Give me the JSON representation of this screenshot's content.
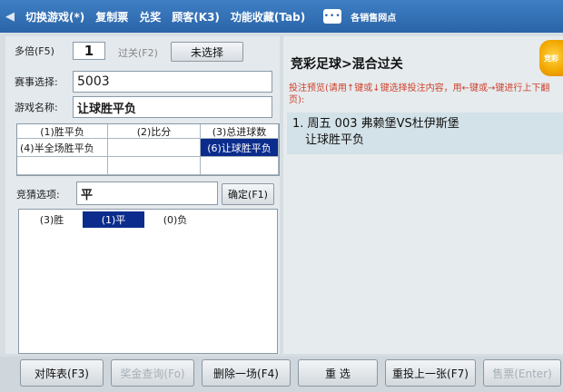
{
  "menubar": {
    "items": [
      "切换游戏(*)",
      "复制票",
      "兑奖",
      "顾客(K3)",
      "功能收藏(Tab)"
    ],
    "message_icon": "chat-bubble-icon",
    "outlet_label": "各销售网点"
  },
  "bet_form": {
    "multiple_label": "多倍(F5)",
    "multiple_value": "1",
    "pass_label": "过关(F2)",
    "pass_value": "未选择",
    "event_label": "赛事选择:",
    "event_value": "5003",
    "game_name_label": "游戏名称:",
    "game_name_value": "让球胜平负"
  },
  "play_types": {
    "rows": [
      [
        {
          "label": "(1)胜平负",
          "selected": false
        },
        {
          "label": "(2)比分",
          "selected": false
        },
        {
          "label": "(3)总进球数",
          "selected": false
        }
      ],
      [
        {
          "label": "(4)半全场胜平负",
          "selected": false
        },
        {
          "label": "",
          "selected": false
        },
        {
          "label": "(6)让球胜平负",
          "selected": true
        }
      ],
      [
        {
          "label": "",
          "selected": false
        },
        {
          "label": "",
          "selected": false
        },
        {
          "label": "",
          "selected": false
        }
      ]
    ]
  },
  "guess": {
    "label": "竞猜选项:",
    "value": "平",
    "confirm_label": "确定(F1)"
  },
  "options": [
    {
      "label": "(3)胜",
      "selected": false
    },
    {
      "label": "(1)平",
      "selected": true
    },
    {
      "label": "(0)负",
      "selected": false
    }
  ],
  "right_panel": {
    "title": "竞彩足球>混合过关",
    "logo_text": "竞彩",
    "hint": "投注预览(请用↑键或↓键选择投注内容，用←键或→键进行上下翻页):",
    "bet_line1": "1. 周五 003  弗赖堡VS杜伊斯堡",
    "bet_line2": "让球胜平负"
  },
  "bottom_buttons": [
    {
      "label": "对阵表(F3)",
      "enabled": true
    },
    {
      "label": "奖金查询(Fo)",
      "enabled": false
    },
    {
      "label": "删除一场(F4)",
      "enabled": true
    },
    {
      "label": "重  选",
      "enabled": true
    },
    {
      "label": "重投上一张(F7)",
      "enabled": true
    },
    {
      "label": "售票(Enter)",
      "enabled": false
    }
  ],
  "colors": {
    "menubar": "#2a64a8",
    "selection": "#0b2c8c",
    "hint": "#d0402a"
  }
}
